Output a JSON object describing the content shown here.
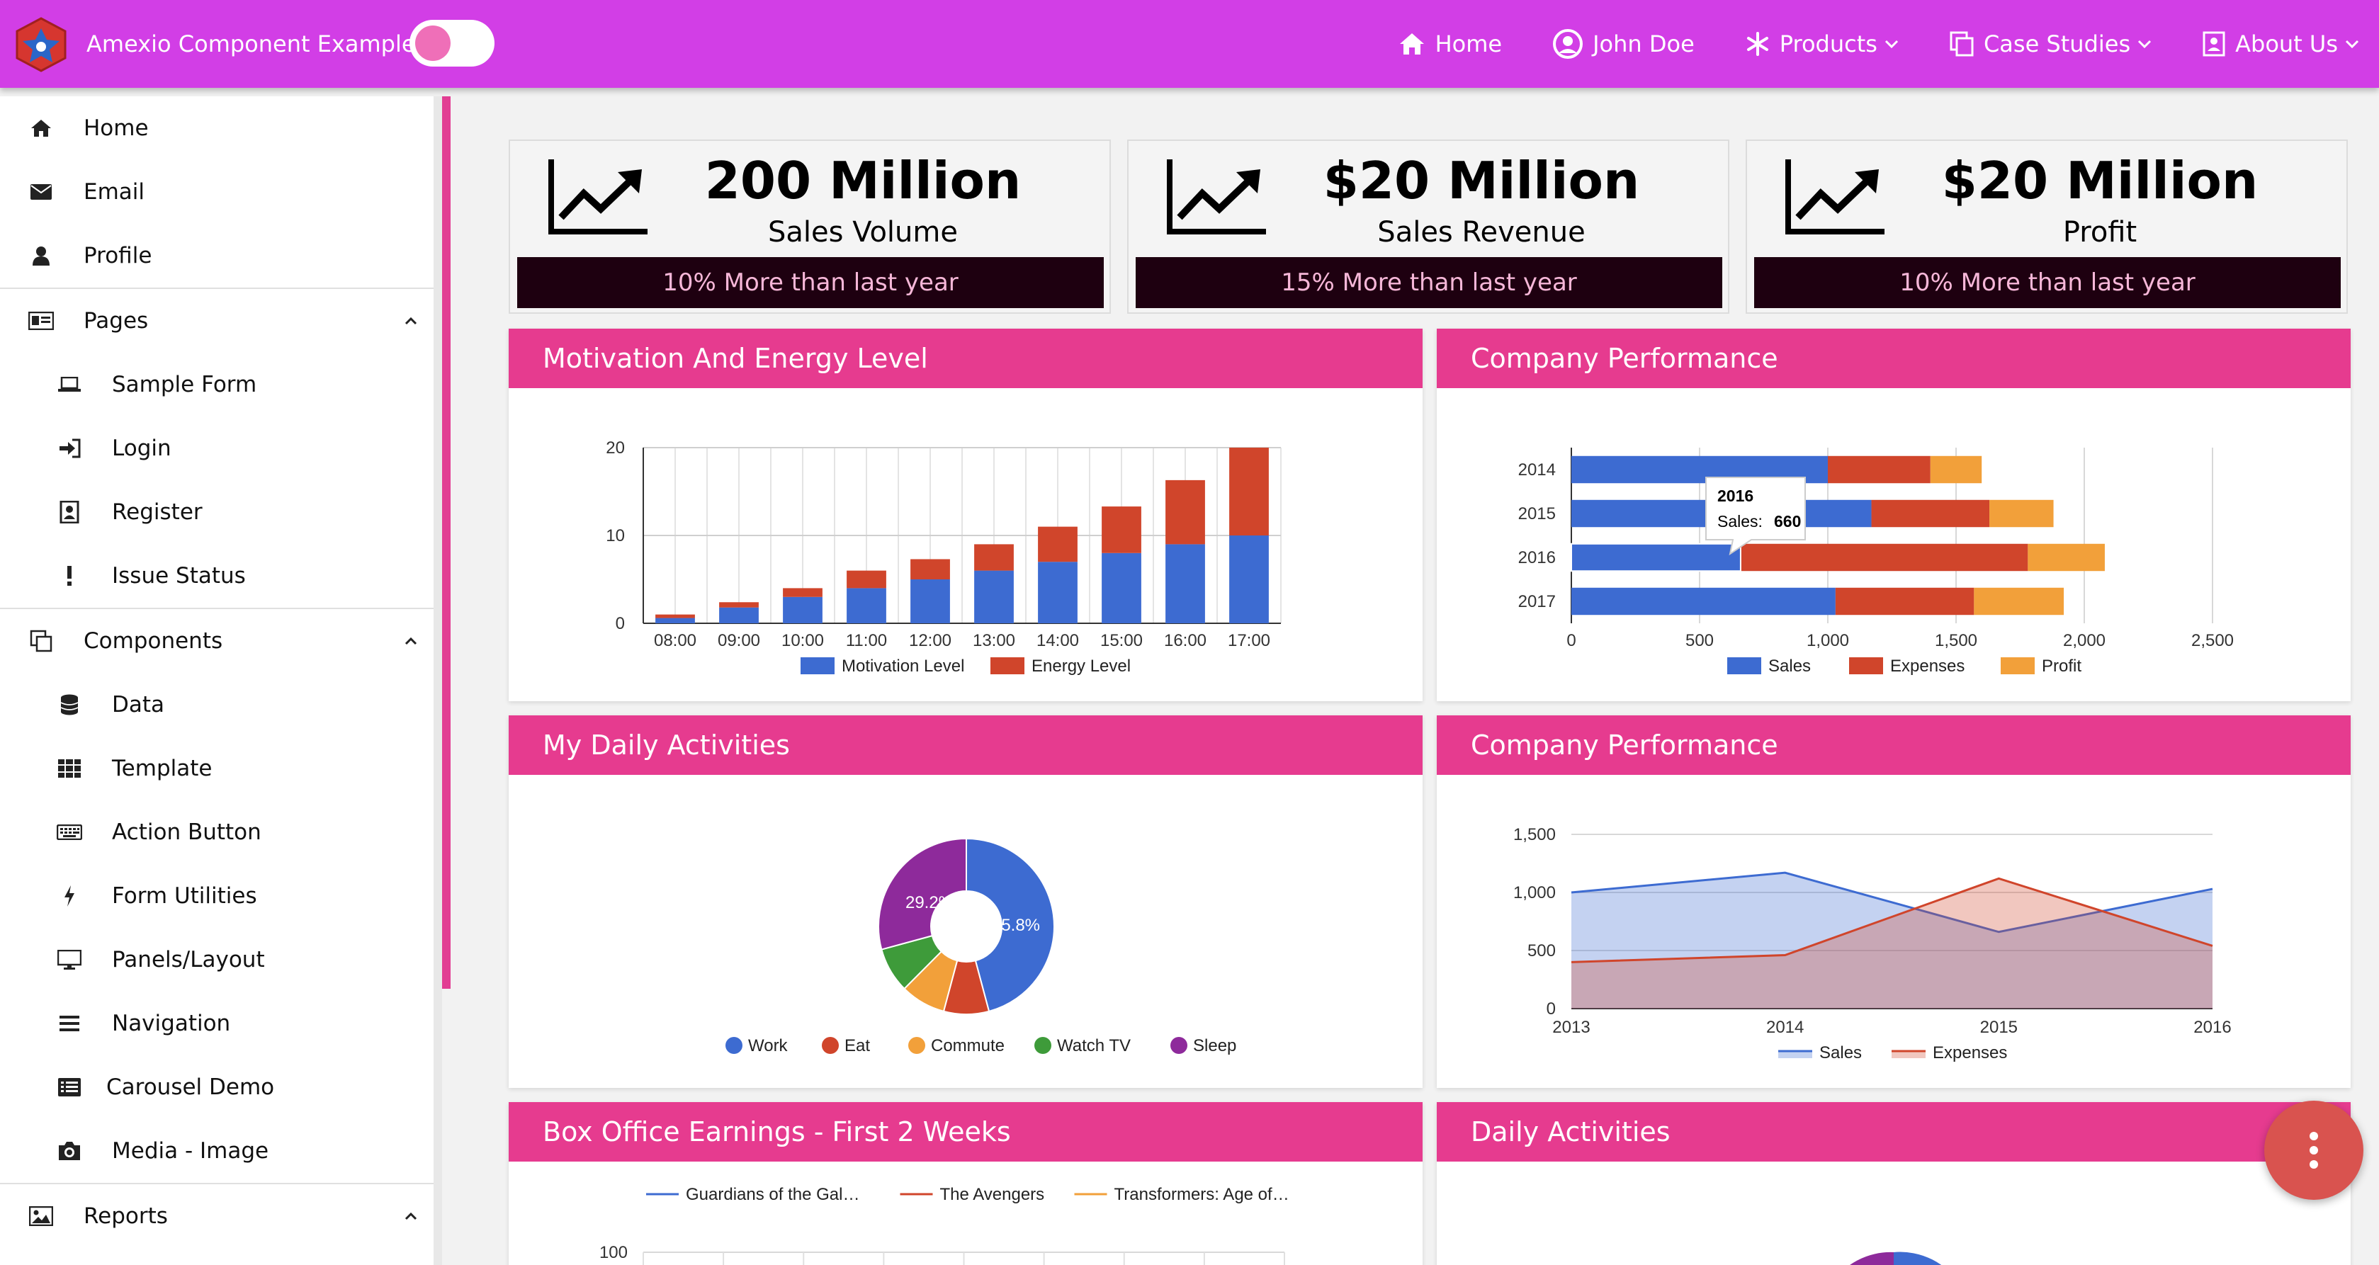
{
  "header": {
    "app_title": "Amexio Component Examples",
    "theme_toggle": "on",
    "nav": [
      {
        "label": "Home",
        "icon": "home-icon"
      },
      {
        "label": "John Doe",
        "icon": "user-circle-icon"
      },
      {
        "label": "Products",
        "icon": "snowflake-icon",
        "dropdown": true
      },
      {
        "label": "Case Studies",
        "icon": "copy-icon",
        "dropdown": true
      },
      {
        "label": "About Us",
        "icon": "address-card-icon",
        "dropdown": true
      }
    ]
  },
  "sidebar": {
    "items": [
      {
        "label": "Home",
        "icon": "home-icon"
      },
      {
        "label": "Email",
        "icon": "envelope-icon"
      },
      {
        "label": "Profile",
        "icon": "user-icon"
      },
      {
        "label": "Pages",
        "icon": "id-card-icon",
        "expanded": true
      },
      {
        "label": "Sample Form",
        "icon": "laptop-icon"
      },
      {
        "label": "Login",
        "icon": "sign-in-icon"
      },
      {
        "label": "Register",
        "icon": "address-book-icon"
      },
      {
        "label": "Issue Status",
        "icon": "exclamation-icon"
      },
      {
        "label": "Components",
        "icon": "clone-icon",
        "expanded": true
      },
      {
        "label": "Data",
        "icon": "database-icon"
      },
      {
        "label": "Template",
        "icon": "th-icon"
      },
      {
        "label": "Action Button",
        "icon": "keyboard-icon"
      },
      {
        "label": "Form Utilities",
        "icon": "bolt-icon"
      },
      {
        "label": "Panels/Layout",
        "icon": "desktop-icon"
      },
      {
        "label": "Navigation",
        "icon": "bars-icon"
      },
      {
        "label": "Carousel Demo",
        "icon": "list-alt-icon"
      },
      {
        "label": "Media - Image",
        "icon": "camera-icon"
      },
      {
        "label": "Reports",
        "icon": "image-icon",
        "expanded": true
      }
    ]
  },
  "stats": [
    {
      "value": "200 Million",
      "label": "Sales Volume",
      "note": "10% More than last year"
    },
    {
      "value": "$20 Million",
      "label": "Sales Revenue",
      "note": "15% More than last year"
    },
    {
      "value": "$20 Million",
      "label": "Profit",
      "note": "10% More than last year"
    }
  ],
  "panels": {
    "motivation_title": "Motivation And Energy Level",
    "company_bar_title": "Company Performance",
    "daily_title": "My Daily Activities",
    "company_area_title": "Company Performance",
    "box_office_title": "Box Office Earnings - First 2 Weeks",
    "daily2_title": "Daily Activities"
  },
  "colors": {
    "topbar": "#d23ee6",
    "panel_header": "#e63b8f",
    "stat_bar": "#1e0010",
    "blue": "#3d6bd1",
    "red": "#d0452b",
    "orange": "#f2a03a",
    "green": "#3e9b3a",
    "purple": "#8e2a9b"
  },
  "chart_data": [
    {
      "type": "bar",
      "stacked": true,
      "title": "Motivation And Energy Level",
      "categories": [
        "08:00",
        "09:00",
        "10:00",
        "11:00",
        "12:00",
        "13:00",
        "14:00",
        "15:00",
        "16:00",
        "17:00"
      ],
      "series": [
        {
          "name": "Motivation Level",
          "color": "#3d6bd1",
          "values": [
            0.6,
            1.8,
            3,
            4,
            5,
            6,
            7,
            8,
            9,
            10
          ]
        },
        {
          "name": "Energy Level",
          "color": "#d0452b",
          "values": [
            0.4,
            0.6,
            1,
            2,
            2.3,
            3,
            4,
            5.3,
            7.3,
            10
          ]
        }
      ],
      "ylim": [
        0,
        20
      ],
      "yticks": [
        0,
        10,
        20
      ],
      "grid": true,
      "legend": "bottom"
    },
    {
      "type": "bar",
      "orientation": "horizontal",
      "stacked": true,
      "title": "Company Performance",
      "categories": [
        "2014",
        "2015",
        "2016",
        "2017"
      ],
      "series": [
        {
          "name": "Sales",
          "color": "#3d6bd1",
          "values": [
            1000,
            1170,
            660,
            1030
          ]
        },
        {
          "name": "Expenses",
          "color": "#d0452b",
          "values": [
            400,
            460,
            1120,
            540
          ]
        },
        {
          "name": "Profit",
          "color": "#f2a03a",
          "values": [
            200,
            250,
            300,
            350
          ]
        }
      ],
      "xlim": [
        0,
        2500
      ],
      "xticks": [
        "0",
        "500",
        "1,000",
        "1,500",
        "2,000",
        "2,500"
      ],
      "tooltip": {
        "title": "2016",
        "label": "Sales:",
        "value": "660"
      },
      "legend": "bottom"
    },
    {
      "type": "pie",
      "donut": true,
      "title": "My Daily Activities",
      "labels": [
        "Work",
        "Eat",
        "Commute",
        "Watch TV",
        "Sleep"
      ],
      "values": [
        45.8,
        8.3,
        8.3,
        8.3,
        29.2
      ],
      "colors": [
        "#3d6bd1",
        "#d0452b",
        "#f2a03a",
        "#3e9b3a",
        "#8e2a9b"
      ],
      "slice_labels": [
        "45.8%",
        "29.2%"
      ],
      "legend": "bottom"
    },
    {
      "type": "area",
      "title": "Company Performance",
      "x": [
        "2013",
        "2014",
        "2015",
        "2016"
      ],
      "series": [
        {
          "name": "Sales",
          "color": "#3d6bd1",
          "values": [
            1000,
            1170,
            660,
            1030
          ]
        },
        {
          "name": "Expenses",
          "color": "#d0452b",
          "values": [
            400,
            460,
            1120,
            540
          ]
        }
      ],
      "ylim": [
        0,
        1500
      ],
      "yticks": [
        "0",
        "500",
        "1,000",
        "1,500"
      ],
      "legend": "bottom"
    },
    {
      "type": "line",
      "title": "Box Office Earnings - First 2 Weeks",
      "series": [
        {
          "name": "Guardians of the Gal…",
          "color": "#3d6bd1"
        },
        {
          "name": "The Avengers",
          "color": "#d0452b"
        },
        {
          "name": "Transformers: Age of…",
          "color": "#f2a03a"
        }
      ],
      "yticks": [
        "100"
      ],
      "legend": "top"
    }
  ]
}
